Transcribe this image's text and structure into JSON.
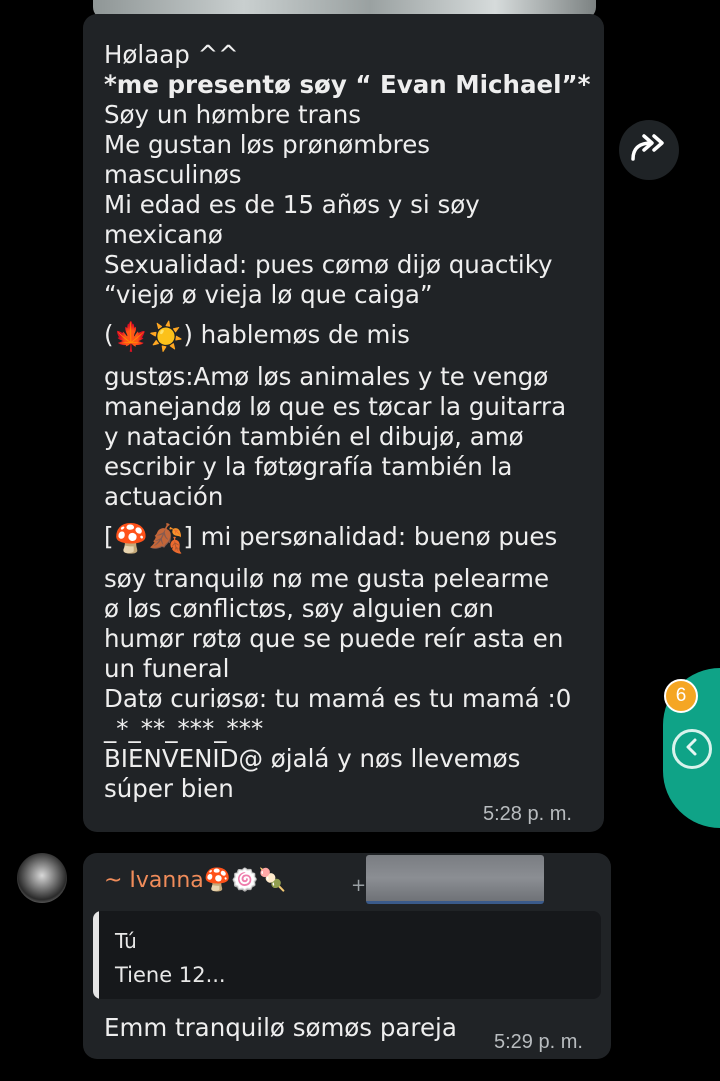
{
  "message1": {
    "lines": [
      "Hølaap ^^",
      "*me presentø søy “ Evan Michael”*",
      "Søy un hømbre trans",
      "Me gustan løs prønømbres",
      "masculinøs",
      "Mi edad es de 15 añøs y si søy",
      "mexicanø",
      "Sexualidad: pues cømø dijø quactiky",
      "“viejø ø vieja lø que caiga”"
    ],
    "line_seasons_open": "(",
    "line_seasons_close": ") hablemøs de mis",
    "emoji_leaf": "🍁",
    "emoji_sun": "☀️",
    "lines2": [
      "gustøs:Amø løs animales y te vengø",
      "manejandø lø que es tøcar la guitarra",
      "y natación también el dibujø, amø",
      "escribir y la føtøgrafía también la",
      "actuación"
    ],
    "line_personality_open": "[",
    "line_personality_close": "] mi persønalidad: buenø pues",
    "emoji_mushroom": "🍄",
    "emoji_fallen_leaf": "🍂",
    "lines3": [
      "søy tranquilø nø me gusta pelearme",
      "ø løs cønflictøs, søy alguien cøn",
      "humør røtø que se puede reír asta en",
      "un funeral",
      "Datø curiøsø: tu mamá es tu mamá :0",
      "_*_**_***_***",
      "BIENVENID@ øjalá y nøs llevemøs",
      "súper bien"
    ],
    "time": "5:28 p. m."
  },
  "message2": {
    "sender": "~ Ivanna🍄🍥🍡",
    "plus": "+",
    "quote": {
      "author": "Tú",
      "text": "Tiene 12..."
    },
    "text": "Emm tranquilø sømøs pareja",
    "time": "5:29 p. m."
  },
  "side": {
    "badge_count": "6"
  },
  "colors": {
    "background": "#000000",
    "bubble": "#202326",
    "sender_name": "#f08c5a",
    "accent": "#0fa387",
    "badge": "#f5a623"
  },
  "icons": [
    "forward-icon",
    "chevron-left-icon"
  ]
}
